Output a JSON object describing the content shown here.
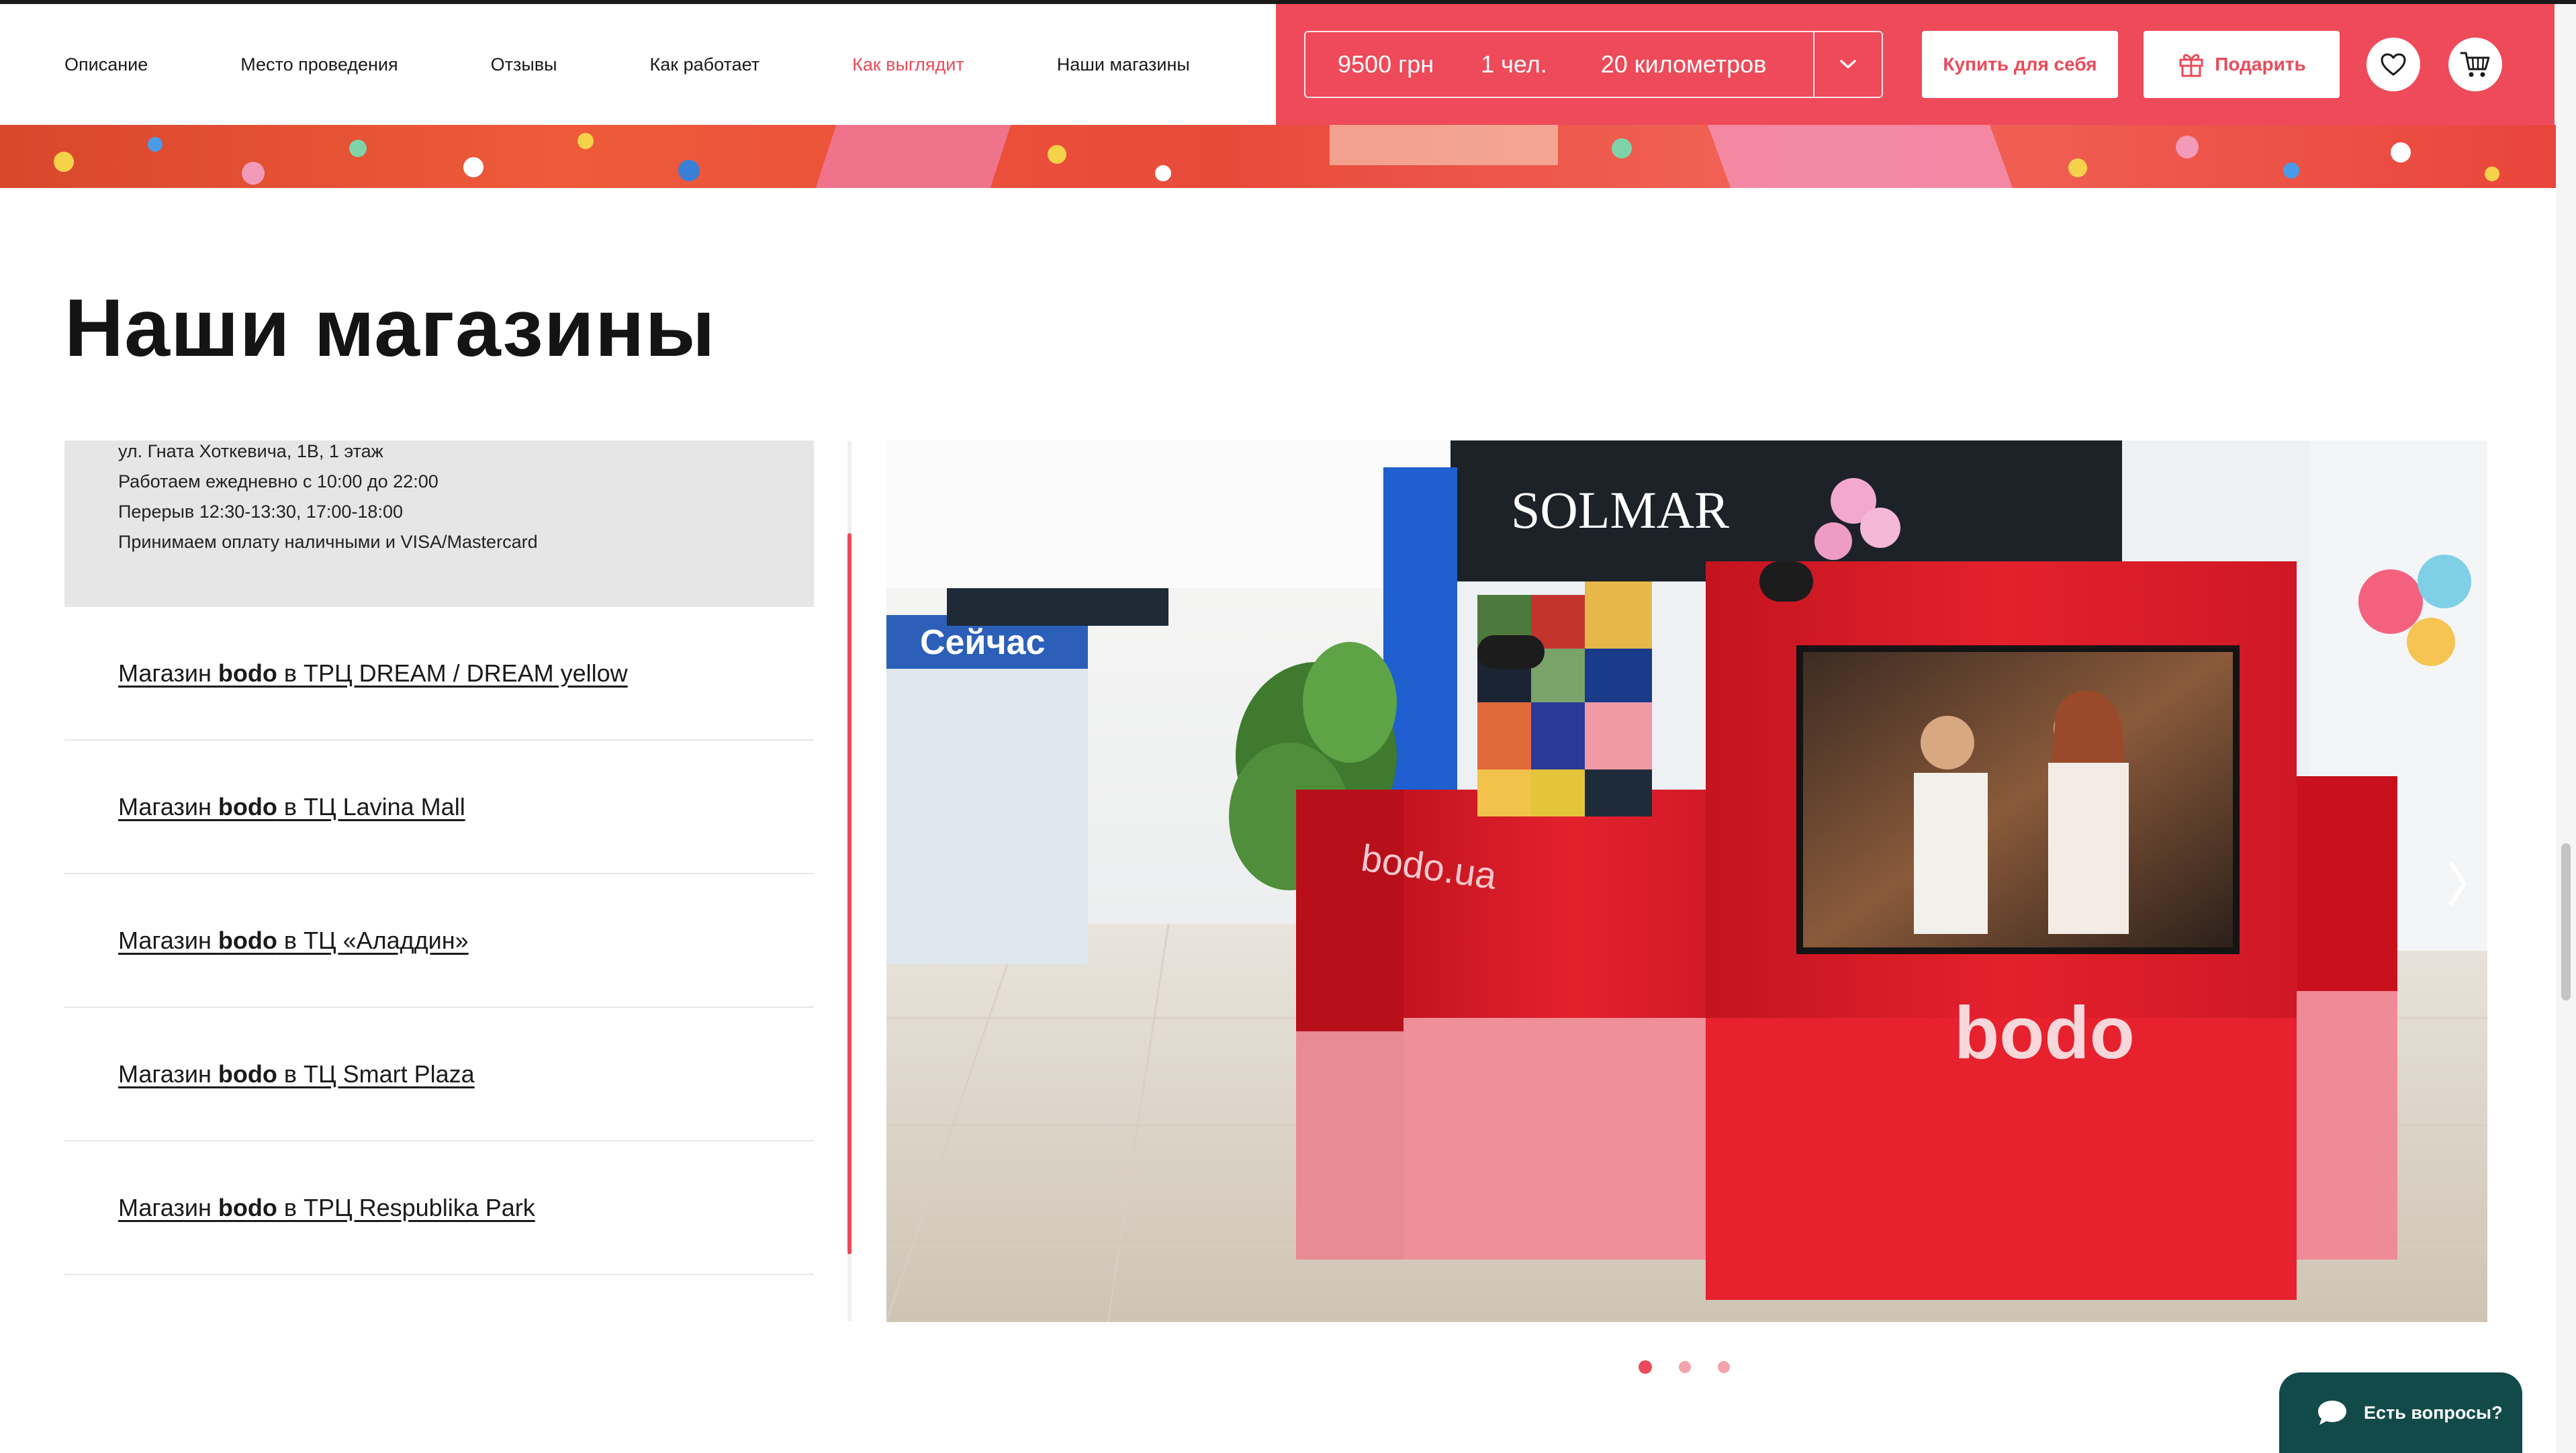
{
  "nav": {
    "items": [
      {
        "label": "Описание",
        "active": false
      },
      {
        "label": "Место проведения",
        "active": false
      },
      {
        "label": "Отзывы",
        "active": false
      },
      {
        "label": "Как работает",
        "active": false
      },
      {
        "label": "Как выглядит",
        "active": true
      },
      {
        "label": "Наши магазины",
        "active": false
      }
    ]
  },
  "purchase": {
    "price": "9500 грн",
    "people": "1 чел.",
    "distance": "20 километров",
    "buy_label": "Купить для себя",
    "gift_label": "Подарить"
  },
  "section": {
    "title": "Наши магазины"
  },
  "stores": {
    "open_details": [
      "ул. Гната Хоткевича, 1В, 1 этаж",
      "Работаем ежедневно с 10:00 до 22:00",
      "Перерыв 12:30-13:30, 17:00-18:00",
      "Принимаем оплату наличными и VISA/Mastercard"
    ],
    "items": [
      {
        "prefix": "Магазин ",
        "brand": "bodo",
        "suffix": " в ТРЦ DREAM / DREAM yellow"
      },
      {
        "prefix": "Магазин ",
        "brand": "bodo",
        "suffix": " в ТЦ Lavina Mall"
      },
      {
        "prefix": "Магазин ",
        "brand": "bodo",
        "suffix": " в ТЦ «Аладдин»"
      },
      {
        "prefix": "Магазин ",
        "brand": "bodo",
        "suffix": " в ТЦ Smart Plaza"
      },
      {
        "prefix": "Магазин ",
        "brand": "bodo",
        "suffix": " в ТРЦ Respublika Park"
      }
    ]
  },
  "photo": {
    "kiosk_brand": "bodo",
    "kiosk_side_text": "bodo.ua",
    "store_sign": "SOLMAR",
    "mall_sign": "Сейчас"
  },
  "carousel": {
    "active_index": 0,
    "count": 3
  },
  "chat": {
    "label": "Есть вопросы?"
  },
  "colors": {
    "accent": "#ee4a5a",
    "nav_active": "#e94b5a",
    "chat_bg": "#124a4a"
  },
  "icons": [
    "chevron-down-icon",
    "gift-icon",
    "heart-icon",
    "cart-icon",
    "chat-bubble-icon"
  ]
}
